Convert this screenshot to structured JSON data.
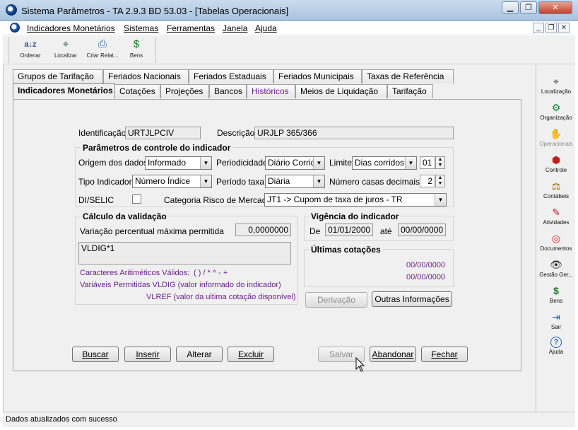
{
  "window": {
    "title": "Sistema Parâmetros -  TA 2.9.3 BD 53.03 - [Tabelas Operacionais]"
  },
  "menu": {
    "items": [
      "Indicadores Monetários",
      "Sistemas",
      "Ferramentas",
      "Janela",
      "Ajuda"
    ]
  },
  "toolbar": {
    "buttons": [
      {
        "label": "Ordenar",
        "icon": "sort-az-icon"
      },
      {
        "label": "Localizar",
        "icon": "locate-icon"
      },
      {
        "label": "Criar Relat...",
        "icon": "printer-icon"
      },
      {
        "label": "Bens",
        "icon": "money-bag-icon"
      }
    ]
  },
  "tabs": {
    "row1": [
      "Grupos de Tarifação",
      "Feriados Nacionais",
      "Feriados Estaduais",
      "Feriados Municipais",
      "Taxas de Referência"
    ],
    "row2": [
      "Indicadores Monetários",
      "Cotações",
      "Projeções",
      "Bancos",
      "Históricos",
      "Meios de Liquidação",
      "Tarifação"
    ]
  },
  "form": {
    "identificacao_label": "Identificação",
    "identificacao_value": "URTJLPCIV",
    "descricao_label": "Descrição",
    "descricao_value": "URJLP 365/366",
    "params_title": "Parâmetros de controle do indicador",
    "origem_label": "Origem dos dados",
    "origem_value": "Informado",
    "periodicidade_label": "Periodicidade",
    "periodicidade_value": "Diário Corrido",
    "limite_label": "Limite",
    "limite_value": "Dias corridos",
    "limite_num": "01",
    "tipo_label": "Tipo Indicador",
    "tipo_value": "Número Índice",
    "periodo_label": "Período taxa",
    "periodo_value": "Diária",
    "casas_label": "Número casas decimais",
    "casas_value": "2",
    "diselic_label": "DI/SELIC",
    "diselic_checked": false,
    "categoria_label": "Categoria Risco de Mercado",
    "categoria_value": "JT1 -> Cupom de taxa de juros - TR"
  },
  "validacao": {
    "title": "Cálculo da validação",
    "variacao_label": "Variação percentual máxima permitida",
    "variacao_value": "0,0000000",
    "formula": "VLDIG*1",
    "caracteres": "Caracteres Aritiméticos Válidos:",
    "caracteres_chars": "( ) / * ^ - +",
    "variaveis": "Variáveis Permitidas VLDIG  (valor informado do indicador)",
    "vlref": "VLREF (valor da ultima cotação disponível)"
  },
  "vigencia": {
    "title": "Vigência do indicador",
    "de_label": "De",
    "de_value": "01/01/2000",
    "ate_label": "até",
    "ate_value": "00/00/0000"
  },
  "cotacoes": {
    "title": "Últimas cotações",
    "values": [
      "00/00/0000",
      "00/00/0000"
    ]
  },
  "buttons": {
    "derivacao": "Derivação",
    "outras": "Outras Informações",
    "buscar": "Buscar",
    "inserir": "Inserir",
    "alterar": "Alterar",
    "excluir": "Excluir",
    "salvar": "Salvar",
    "abandonar": "Abandonar",
    "fechar": "Fechar"
  },
  "sidebar": {
    "buttons": [
      {
        "label": "Localização",
        "icon": "locate-icon",
        "disabled": false
      },
      {
        "label": "Organização",
        "icon": "organization-icon",
        "disabled": false
      },
      {
        "label": "Operacionais",
        "icon": "handshake-icon",
        "disabled": true
      },
      {
        "label": "Controle",
        "icon": "stop-sign-icon",
        "disabled": false
      },
      {
        "label": "Contábeis",
        "icon": "scale-icon",
        "disabled": false
      },
      {
        "label": "Atividades",
        "icon": "pin-icon",
        "disabled": false
      },
      {
        "label": "Documentos",
        "icon": "target-icon",
        "disabled": false
      },
      {
        "label": "Gestão Ger...",
        "icon": "eye-icon",
        "disabled": false
      },
      {
        "label": "Bens",
        "icon": "money-bag-icon",
        "disabled": false
      },
      {
        "label": "Sair",
        "icon": "exit-icon",
        "disabled": false
      },
      {
        "label": "Ajuda",
        "icon": "help-icon",
        "disabled": false
      }
    ]
  },
  "status": {
    "message": "Dados atualizados com sucesso"
  },
  "colors": {
    "accent_purple": "#6b1f8a",
    "title_gradient": "#a9c4e0"
  }
}
